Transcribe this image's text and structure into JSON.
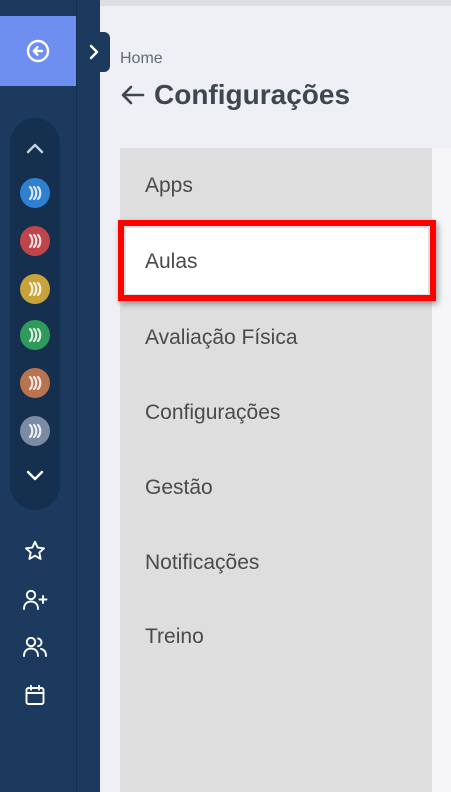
{
  "breadcrumb": "Home",
  "page_title": "Configurações",
  "menu": {
    "items": [
      {
        "label": "Apps",
        "active": false
      },
      {
        "label": "Aulas",
        "active": true
      },
      {
        "label": "Avaliação Física",
        "active": false
      },
      {
        "label": "Configurações",
        "active": false
      },
      {
        "label": "Gestão",
        "active": false
      },
      {
        "label": "Notificações",
        "active": false
      },
      {
        "label": "Treino",
        "active": false
      }
    ]
  },
  "rail": {
    "app_colors": [
      "#2f7fd3",
      "#c0454a",
      "#c9a23a",
      "#2e9a5b",
      "#b9734f",
      "#7d8aa3"
    ],
    "icons": [
      "star-icon",
      "add-user-icon",
      "users-icon",
      "calendar-icon"
    ]
  },
  "colors": {
    "rail_bg": "#1c3a5e",
    "rail_accent": "#6f8ff0",
    "highlight": "#ff0000"
  }
}
